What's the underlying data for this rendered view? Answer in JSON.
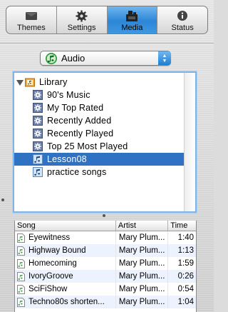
{
  "tabs": [
    {
      "label": "Themes",
      "icon": "themes-icon",
      "active": false
    },
    {
      "label": "Settings",
      "icon": "gear-icon",
      "active": false
    },
    {
      "label": "Media",
      "icon": "media-icon",
      "active": true
    },
    {
      "label": "Status",
      "icon": "info-icon",
      "active": false
    }
  ],
  "media_popup": {
    "selected": "Audio",
    "icon": "music-note-icon"
  },
  "library": {
    "root_label": "Library",
    "items": [
      {
        "label": "90's Music",
        "icon": "smart-playlist-icon",
        "selected": false
      },
      {
        "label": "My Top Rated",
        "icon": "smart-playlist-icon",
        "selected": false
      },
      {
        "label": "Recently Added",
        "icon": "smart-playlist-icon",
        "selected": false
      },
      {
        "label": "Recently Played",
        "icon": "smart-playlist-icon",
        "selected": false
      },
      {
        "label": "Top 25 Most Played",
        "icon": "smart-playlist-icon",
        "selected": false
      },
      {
        "label": "Lesson08",
        "icon": "playlist-icon",
        "selected": true
      },
      {
        "label": "practice songs",
        "icon": "playlist-icon",
        "selected": false
      }
    ]
  },
  "tracks": {
    "columns": [
      "Song",
      "Artist",
      "Time"
    ],
    "rows": [
      {
        "song": "Eyewitness",
        "artist": "Mary Plum...",
        "time": "1:40"
      },
      {
        "song": "Highway Bound",
        "artist": "Mary Plum...",
        "time": "1:13"
      },
      {
        "song": "Homecoming",
        "artist": "Mary Plum...",
        "time": "1:59"
      },
      {
        "song": "IvoryGroove",
        "artist": "Mary Plum...",
        "time": "0:26"
      },
      {
        "song": "SciFiShow",
        "artist": "Mary Plum...",
        "time": "0:54"
      },
      {
        "song": "Techno80s shorten...",
        "artist": "Mary Plum...",
        "time": "1:04"
      }
    ]
  },
  "colors": {
    "accent": "#2f72c4",
    "tab_active": "#2b86d6",
    "row_alt": "#edf3fe"
  }
}
